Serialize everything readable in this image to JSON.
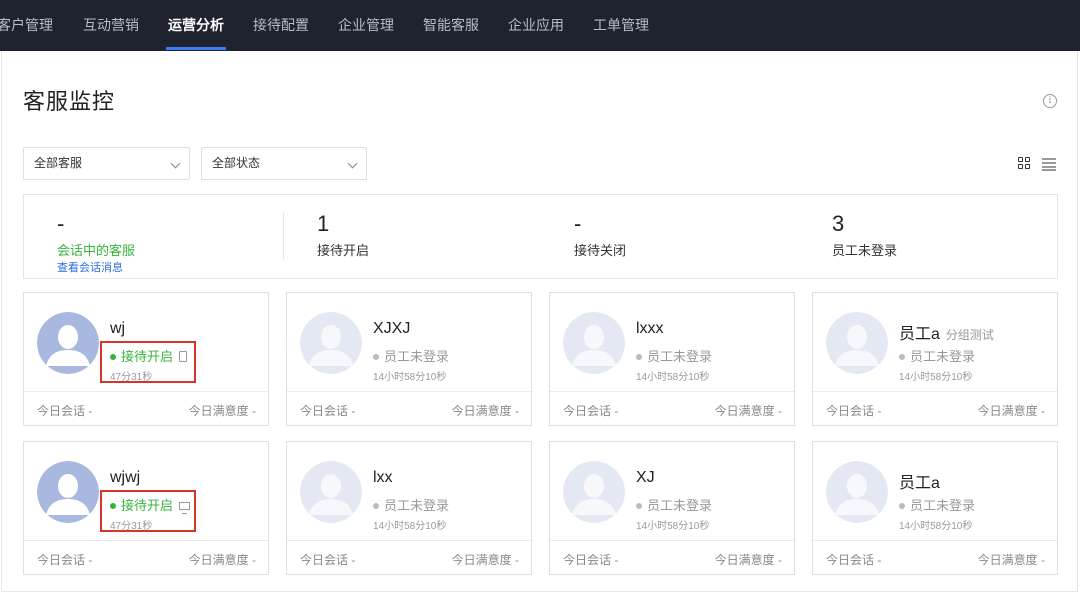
{
  "nav": {
    "items": [
      "客户管理",
      "互动营销",
      "运营分析",
      "接待配置",
      "企业管理",
      "智能客服",
      "企业应用",
      "工单管理"
    ],
    "active_index": 2
  },
  "page": {
    "title": "客服监控",
    "info_icon": "info-icon"
  },
  "filters": {
    "agent": "全部客服",
    "status": "全部状态"
  },
  "stats": [
    {
      "value": "-",
      "label": "会话中的客服",
      "link": "查看会话消息"
    },
    {
      "value": "1",
      "label": "接待开启"
    },
    {
      "value": "-",
      "label": "接待关闭"
    },
    {
      "value": "3",
      "label": "员工未登录"
    }
  ],
  "agents": [
    {
      "name": "wj",
      "group": "",
      "status": "接待开启",
      "online": true,
      "device": "phone-icon",
      "time": "47分31秒",
      "today_sessions": "今日会话 -",
      "today_satisfaction": "今日满意度 -"
    },
    {
      "name": "XJXJ",
      "group": "",
      "status": "员工未登录",
      "online": false,
      "device": "",
      "time": "14小时58分10秒",
      "today_sessions": "今日会话 -",
      "today_satisfaction": "今日满意度 -"
    },
    {
      "name": "lxxx",
      "group": "",
      "status": "员工未登录",
      "online": false,
      "device": "",
      "time": "14小时58分10秒",
      "today_sessions": "今日会话 -",
      "today_satisfaction": "今日满意度 -"
    },
    {
      "name": "员工a",
      "group": "分组测试",
      "status": "员工未登录",
      "online": false,
      "device": "",
      "time": "14小时58分10秒",
      "today_sessions": "今日会话 -",
      "today_satisfaction": "今日满意度 -"
    },
    {
      "name": "wjwj",
      "group": "",
      "status": "接待开启",
      "online": true,
      "device": "desktop-icon",
      "time": "47分31秒",
      "today_sessions": "今日会话 -",
      "today_satisfaction": "今日满意度 -"
    },
    {
      "name": "lxx",
      "group": "",
      "status": "员工未登录",
      "online": false,
      "device": "",
      "time": "14小时58分10秒",
      "today_sessions": "今日会话 -",
      "today_satisfaction": "今日满意度 -"
    },
    {
      "name": "XJ",
      "group": "",
      "status": "员工未登录",
      "online": false,
      "device": "",
      "time": "14小时58分10秒",
      "today_sessions": "今日会话 -",
      "today_satisfaction": "今日满意度 -"
    },
    {
      "name": "员工a",
      "group": "",
      "status": "员工未登录",
      "online": false,
      "device": "",
      "time": "14小时58分10秒",
      "today_sessions": "今日会话 -",
      "today_satisfaction": "今日满意度 -"
    }
  ],
  "colors": {
    "online": "#35b53c",
    "offline": "#999999",
    "highlight": "#d9342b",
    "nav_bg": "#1f2330",
    "accent": "#3a7cf4",
    "link": "#2a6ee0"
  }
}
